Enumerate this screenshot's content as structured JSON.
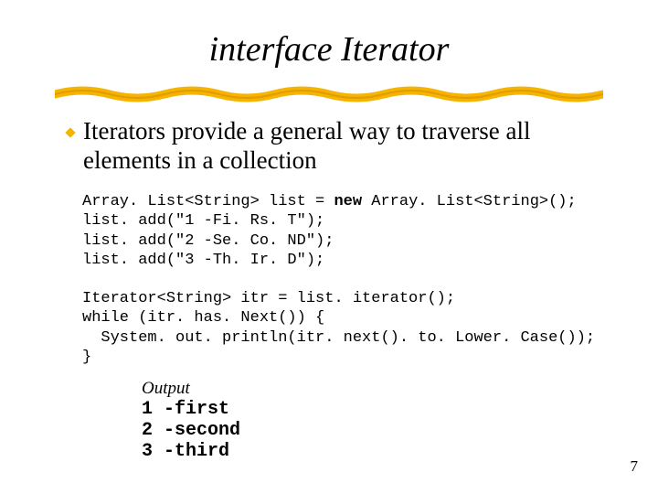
{
  "title": "interface Iterator",
  "bullet": "Iterators provide a general way to traverse all elements in a collection",
  "code_decl_prefix": "Array. List<String> list = ",
  "code_new": "new",
  "code_decl_suffix": " Array. List<String>();",
  "code_add1": "list. add(\"1 -Fi. Rs. T\");",
  "code_add2": "list. add(\"2 -Se. Co. ND\");",
  "code_add3": "list. add(\"3 -Th. Ir. D\");",
  "code_iter": "Iterator<String> itr = list. iterator();",
  "code_while": "while (itr. has. Next()) {",
  "code_print": "  System. out. println(itr. next(). to. Lower. Case());",
  "code_close": "}",
  "output_label": "Output",
  "output": "1 -first\n2 -second\n3 -third",
  "pagenum": "7"
}
